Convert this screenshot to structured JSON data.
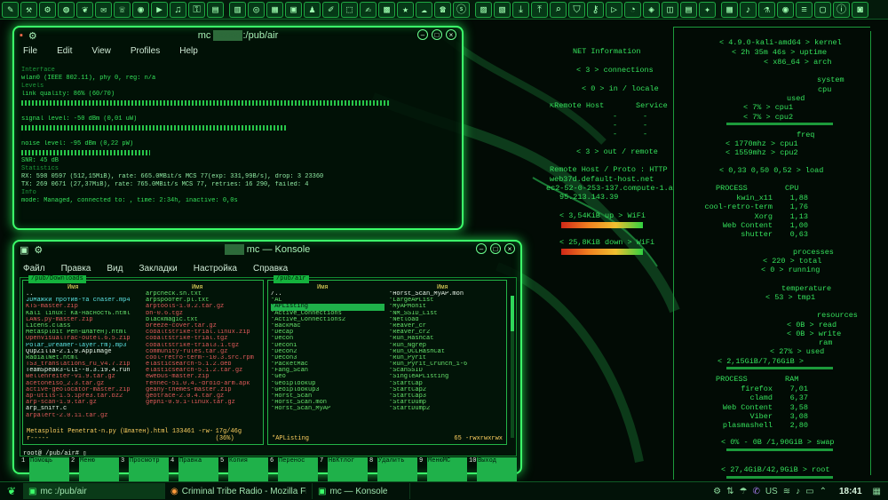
{
  "topbar": {
    "icons": [
      "wrench-icon",
      "tool-icon",
      "settings-icon",
      "globe-icon",
      "leaf-icon",
      "mail-icon",
      "chat-icon",
      "camera-icon",
      "video-icon",
      "music-icon",
      "lock-icon",
      "file-icon",
      "folder-icon",
      "web-icon",
      "chart-icon",
      "terminal-icon",
      "game-icon",
      "paint-icon",
      "disk-icon",
      "note-icon",
      "calendar-icon",
      "star-icon",
      "cloud-icon",
      "phone-icon",
      "skype-icon",
      "image-icon",
      "book-icon",
      "download-icon",
      "upload-icon",
      "search-icon",
      "shield-icon",
      "key-icon",
      "video2-icon",
      "radio-icon",
      "map-icon",
      "ham-icon",
      "book2-icon",
      "gear2-icon",
      "table-icon",
      "sound-icon",
      "lab-icon",
      "eye-icon",
      "mixer-icon",
      "window-icon",
      "info-icon",
      "camera2-icon"
    ]
  },
  "wavemon": {
    "title": "mc",
    "title_path": ":/pub/air",
    "menu": [
      "File",
      "Edit",
      "View",
      "Profiles",
      "Help"
    ],
    "lines": {
      "interface_label": "Interface",
      "interface": "wlan0 (IEEE 802.11), phy 0, reg: n/a",
      "levels_label": "Levels",
      "link_quality": "link quality: 86%  (60/70)",
      "signal": "signal level: -50 dBm (0,01 uW)",
      "noise": "noise level:  -95 dBm (0,22 pW)",
      "snr": "SNR:            45 dB",
      "stats_label": "Statistics",
      "rx": "RX: 598 0597 (512,15MiB), rate: 665.0MBit/s MCS 77(exp: 331,99B/s), drop: 3 23360",
      "tx": "TX: 269 0671 (27,37MiB), rate: 765.0MBit/s MCS 77, retries: 16 290, failed: 4",
      "info_label": "Info",
      "mode": "mode: Managed, connected to:                     , time: 2:34h, inactive: 0,0s"
    }
  },
  "konsole": {
    "title": "mc — Konsole",
    "menu": [
      "Файл",
      "Правка",
      "Вид",
      "Закладки",
      "Настройка",
      "Справка"
    ],
    "left_panel": {
      "path": "/pub/Downloads",
      "col_name": "Имя",
      "col_name2": "Имя",
      "files_a": [
        "..",
        "JDМажки против-та chaser.mp4",
        "KTS-master.zip",
        "Kali linux: Ка-насность.html",
        "LANs.py-master.zip",
        "Licens.class",
        "Metasploit Pen-Шлатен).html",
        "OpenVisualTrac-outel.6.5.zip",
        "Polar_Dreamer-layer.fm).mp3",
        "QupZilla-2.1.9.AppImage",
        "RadialNet.html",
        "TS3_translations_ru_v4.7.zip",
        "TeamSpeak3-Cli--8.3.19.4.run",
        "Wellenreiter-v1.9.tar.gz",
        "acetoneiso_2.3.tar.gz",
        "active-geolocator-master.zip",
        "ap-utils-1.5.1pre3.tar.bz2",
        "arp-scan-1.9.tar.gz",
        "arp_sniff.c",
        "arpalert-2.0.11.tar.gz"
      ],
      "files_b": [
        "arpcheck.sh.txt",
        "arpspoofer.pl.txt",
        "arptools-1.0.2.tar.gz",
        "bh-0.6.tgz",
        "blackmagic.txt",
        "breeze-cover.tar.gz",
        "cobaltstrike-trial.linux.zip",
        "cobaltstrike-trial.tgz",
        "cobaltstrike-trial3.1.tgz",
        "community-rules.tar.gz",
        "cool-retro-term--10.3.src.rpm",
        "elasticsearch-5.1.2.deb",
        "elasticsearch-5.1.2.tar.gz",
        "ewebus-master.zip",
        "fennec-51.0.4.-droid-arm.apk",
        "geany-themes-master.zip",
        "geotrace-2.0.4.tar.gz",
        "gephi-0.9.1-linux.tar.gz"
      ],
      "footer_name": "Metasploit Penetrat-n.py (Шлатен).html",
      "footer_size": "133461",
      "footer_perm": "-rw-r-----",
      "footer_disk": "17g/46g (36%)"
    },
    "right_panel": {
      "path": "/pub/air",
      "col_name": "Имя",
      "col_name2": "Имя",
      "files_a": [
        "/..",
        "*AL",
        "*APListing",
        "*Active_Connections",
        "*Active_Connections2",
        "*BackMac",
        "*Decap",
        "*Decon",
        "*Decon1",
        "*Decon2",
        "*Decon3",
        "*PacketMac",
        "*Fang_Scan",
        "*Geo",
        "*Geoiplookup",
        "*Geoiplookup3",
        "*Horst_Scan",
        "*Horst_Scan.mon",
        "*Horst_Scan_MyAP"
      ],
      "files_b": [
        "*Horst_Scan_MyAP.mon",
        "*LargeAPList",
        "*MyAPMonit",
        "*NM_SSID_List",
        "*Netload",
        "*Reaver_cr",
        "*Reaver_cr2",
        "*Run_Hashcat",
        "*Run_Ngrep",
        "*Run_OCLHashCat",
        "*Run_Pyrit",
        "*Run_Pyrit_Crunch_1-6",
        "*ScanSSID",
        "*SingleAPListing",
        "*StartCap",
        "*StartCap2",
        "*StartCap3",
        "*StartDump",
        "*StartDump2"
      ],
      "footer_name": "*APListing",
      "footer_size": "65",
      "footer_perm": "-rwxrwxrwx",
      "footer_disk": "17g/46g (36%)"
    },
    "prompt": "root@          /pub/air# ▯",
    "fkeys": [
      {
        "n": "1",
        "l": "Помощь"
      },
      {
        "n": "2",
        "l": "Меню"
      },
      {
        "n": "3",
        "l": "Просмотр"
      },
      {
        "n": "4",
        "l": "Правка"
      },
      {
        "n": "5",
        "l": "Копия"
      },
      {
        "n": "6",
        "l": "Перенос"
      },
      {
        "n": "7",
        "l": "НвКтлог"
      },
      {
        "n": "8",
        "l": "Удалить"
      },
      {
        "n": "9",
        "l": "МенюМС"
      },
      {
        "n": "10",
        "l": "Выход"
      }
    ]
  },
  "conky": {
    "net_info": "NET Information",
    "connections": "< 3 > connections",
    "in_locale": "< 0 > in / locale",
    "remote_host": "Remote Host",
    "service": "Service",
    "dash": "-",
    "out_remote": "< 3 > out / remote",
    "remote_proto": "Remote Host / Proto : HTTP",
    "host1": "web37d.default-host.net",
    "host2": "ec2-52-0-253-137.compute-1.a",
    "host3": "95.213.143.39",
    "up": "< 3,54KiB  up  >  WiFi",
    "down": "< 25,8KiB down  >  WiFi",
    "kernel": "< 4.9.0-kali-amd64 > kernel",
    "uptime": "< 2h 35m 46s > uptime",
    "arch": "< x86_64 > arch",
    "system": "system",
    "cpu": "cpu",
    "used": "used",
    "cpu1": "< 7% > cpu1",
    "cpu2": "< 7% > cpu2",
    "freq": "freq",
    "f1": "< 1770mhz > cpu1",
    "f2": "< 1559mhz > cpu2",
    "load": "< 0,33 0,50 0,52 > load",
    "process_h": "PROCESS",
    "cpu_h": "CPU",
    "procs": [
      {
        "name": "kwin_x11",
        "val": "1,88"
      },
      {
        "name": "cool-retro-term",
        "val": "1,76"
      },
      {
        "name": "Xorg",
        "val": "1,13"
      },
      {
        "name": "Web Content",
        "val": "1,00"
      },
      {
        "name": "shutter",
        "val": "0,63"
      }
    ],
    "processes": "processes",
    "total": "< 220 > total",
    "running": "< 0 > running",
    "temperature": "temperature",
    "tmp1": "< 53 > tmp1",
    "resources": "resources",
    "read": "< 0B > read",
    "write": "< 0B > write",
    "ram": "ram",
    "ram_used": "< 27% > used",
    "ram_amount": "< 2,15GiB/7,76GiB >",
    "process_h2": "PROCESS",
    "ram_h": "RAM",
    "procs2": [
      {
        "name": "firefox",
        "val": "7,01"
      },
      {
        "name": "clamd",
        "val": "6,37"
      },
      {
        "name": "Web Content",
        "val": "3,58"
      },
      {
        "name": "Viber",
        "val": "3,08"
      },
      {
        "name": "plasmashell",
        "val": "2,80"
      }
    ],
    "swap": "< 0% - 0B /1,90GiB > swap",
    "root": "< 27,4GiB/42,9GiB > root"
  },
  "taskbar": {
    "tasks": [
      {
        "label": "mc          :/pub/air",
        "icon": "terminal-icon"
      },
      {
        "label": "Criminal Tribe Radio - Mozilla Fir...",
        "icon": "firefox-icon"
      },
      {
        "label": "        mc — Konsole",
        "icon": "konsole-icon"
      }
    ],
    "lang": "US",
    "time": "18:41"
  }
}
